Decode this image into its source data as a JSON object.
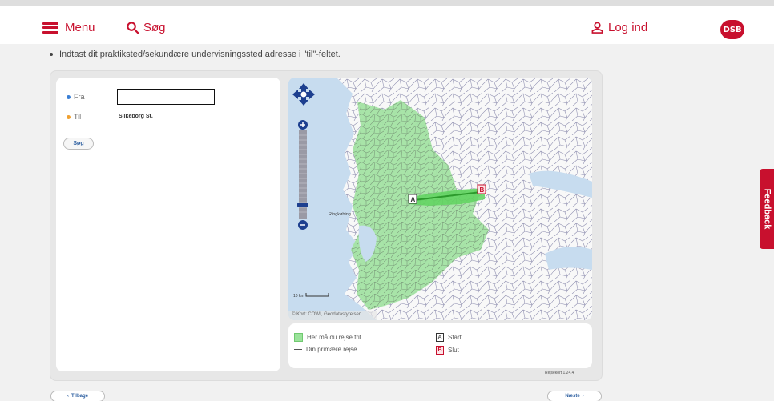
{
  "header": {
    "menu_label": "Menu",
    "search_label": "Søg",
    "login_label": "Log ind",
    "logo_text": "DSB",
    "brand_color": "#c8102e"
  },
  "instruction": "Indtast dit praktiksted/sekundære undervisningssted adresse i \"til\"-feltet.",
  "form": {
    "fra_label": "Fra",
    "fra_value": "",
    "til_label": "Til",
    "til_value": "Silkeborg St.",
    "search_button": "Søg"
  },
  "map": {
    "scale_text": "10 km",
    "credit_text": "© Kort: COWI, Geodatastyrelsen",
    "place_label": "Ringkøbing"
  },
  "legend": {
    "free_travel_label": "Her må du rejse frit",
    "primary_route_label": "Din primære rejse",
    "start_marker": "A",
    "start_label": "Start",
    "end_marker": "B",
    "end_label": "Slut"
  },
  "version": "Rejsekort 1.24.4",
  "footer": {
    "back_label": "Tilbage",
    "next_label": "Næste"
  },
  "feedback_label": "Feedback"
}
